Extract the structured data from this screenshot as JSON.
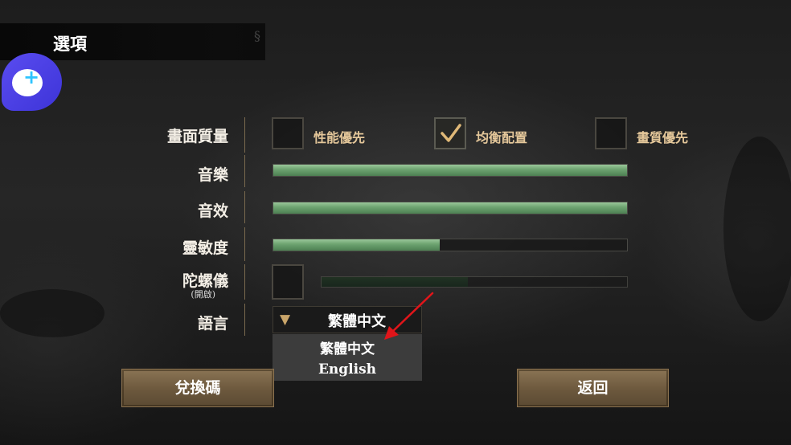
{
  "title": "選項",
  "rows": {
    "quality": {
      "label": "畫面質量"
    },
    "music": {
      "label": "音樂",
      "value": 1.0
    },
    "sfx": {
      "label": "音效",
      "value": 1.0
    },
    "sensitivity": {
      "label": "靈敏度",
      "value": 0.47
    },
    "gyro": {
      "label": "陀螺儀",
      "sublabel": "(開啟)",
      "enabled": false,
      "value": 0.48
    },
    "language": {
      "label": "語言"
    }
  },
  "quality_options": [
    {
      "label": "性能優先",
      "checked": false
    },
    {
      "label": "均衡配置",
      "checked": true
    },
    {
      "label": "畫質優先",
      "checked": false
    }
  ],
  "language_dropdown": {
    "arrow": "▼",
    "selected": "繁體中文",
    "options": [
      "繁體中文",
      "English"
    ]
  },
  "buttons": {
    "redeem": "兌換碼",
    "back": "返回"
  },
  "colors": {
    "slider_fill": "#6fa572",
    "option_text": "#e4c79a",
    "button": "#6c583d",
    "pointer_arrow": "#e0151a",
    "logo": "#4a3ee6"
  }
}
